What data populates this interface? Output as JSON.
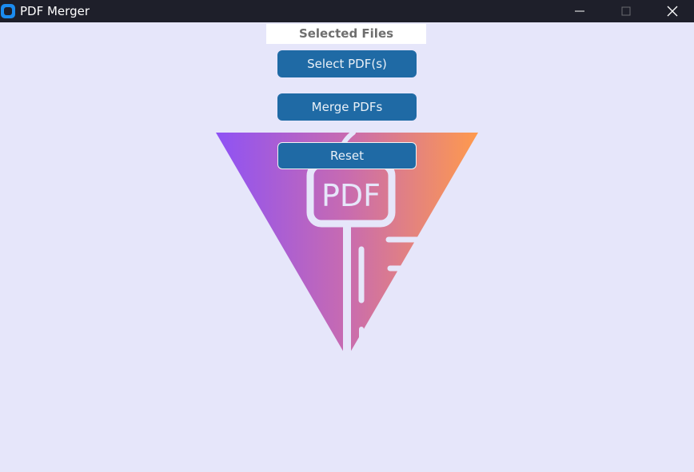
{
  "window": {
    "title": "PDF Merger",
    "icons": {
      "app": "app-icon",
      "minimize": "minimize-icon",
      "maximize": "maximize-icon",
      "close": "close-icon"
    }
  },
  "main": {
    "selected_files_label": "Selected Files",
    "select_button_label": "Select PDF(s)",
    "merge_button_label": "Merge PDFs",
    "reset_button_label": "Reset",
    "logo_text": "PDF"
  },
  "colors": {
    "background": "#e6e6fa",
    "titlebar": "#1e1f2a",
    "button": "#1f6aa5",
    "logo_gradient_start": "#8e52f5",
    "logo_gradient_end": "#ff9a4d"
  }
}
